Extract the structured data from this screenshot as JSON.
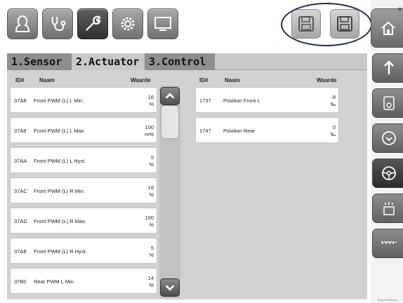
{
  "toolbar": {
    "buttons": [
      "person-icon",
      "stethoscope-icon",
      "wrench-icon",
      "gear-icon",
      "computer-icon"
    ],
    "save_buttons": [
      "save-file-icon",
      "save-icon"
    ]
  },
  "tabs": [
    {
      "label": "1.Sensor"
    },
    {
      "label": "2.Actuator"
    },
    {
      "label": "3.Control"
    }
  ],
  "columns": {
    "id": "ID#",
    "name": "Naam",
    "value": "Waarde"
  },
  "left_rows": [
    {
      "id": "37A8",
      "name": "Front PWM (L) L Min.",
      "value": "16",
      "unit": "%"
    },
    {
      "id": "37A9",
      "name": "Front PWM (L) L Max.",
      "value": "100",
      "unit": "m%"
    },
    {
      "id": "37AA",
      "name": "Front PWM (L) L Hyst.",
      "value": "5",
      "unit": "%"
    },
    {
      "id": "37AC",
      "name": "Front PWM (L) R Min.",
      "value": "16",
      "unit": "%"
    },
    {
      "id": "37AD",
      "name": "Front PWM (L) R Max.",
      "value": "100",
      "unit": "%"
    },
    {
      "id": "37AE",
      "name": "Front PWM (L) R Hyst.",
      "value": "5",
      "unit": "%"
    },
    {
      "id": "37B0",
      "name": "Rear PWM L Min.",
      "value": "14",
      "unit": "%"
    }
  ],
  "right_rows": [
    {
      "id": "1737",
      "name": "Position Front L",
      "value": "-8",
      "unit": "‰"
    },
    {
      "id": "1747",
      "name": "Position Rear",
      "value": "0",
      "unit": "‰"
    }
  ],
  "sidebar": [
    "home-icon",
    "arrow-up-icon",
    "thermometer-icon",
    "circle-down-icon",
    "steering-wheel-icon",
    "spray-icon",
    "ruler-icon"
  ],
  "close_glyph": "×",
  "brand": "EasyHeadlights"
}
